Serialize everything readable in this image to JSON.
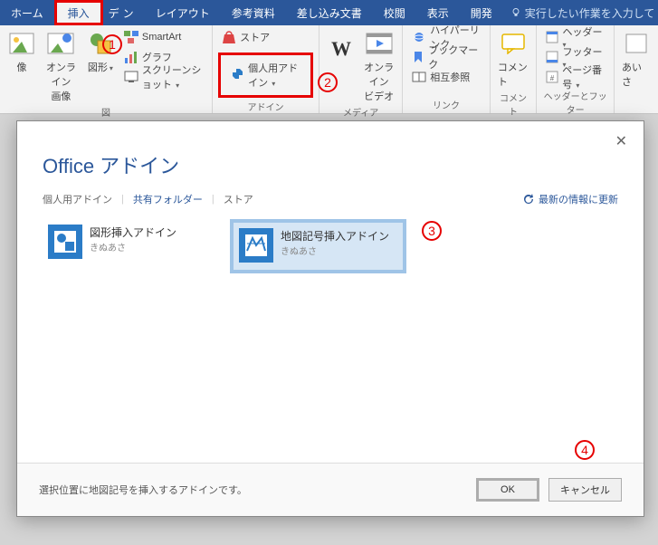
{
  "tabs": {
    "home": "ホーム",
    "insert": "挿入",
    "design_partial": "デ",
    "design_partial2": "ン",
    "layout": "レイアウト",
    "references": "参考資料",
    "mailings": "差し込み文書",
    "review": "校閲",
    "view": "表示",
    "developer": "開発",
    "tellme": "実行したい作業を入力して"
  },
  "ribbon": {
    "pictures": "像",
    "online_images": "オンライン\n画像",
    "shapes": "図形",
    "smartart": "SmartArt",
    "chart": "グラフ",
    "screenshot": "スクリーンショット",
    "illustrations_group": "図",
    "store": "ストア",
    "my_addins": "個人用アドイン",
    "addins_group": "アドイン",
    "wikipedia": "W",
    "online_video": "オンライン\nビデオ",
    "media_group": "メディア",
    "hyperlink": "ハイパーリンク",
    "bookmark": "ブックマーク",
    "crossref": "相互参照",
    "link_group": "リンク",
    "comment": "コメント",
    "comment_group": "コメント",
    "header": "ヘッダー",
    "footer": "フッター",
    "page_number": "ページ番号",
    "header_footer_group": "ヘッダーとフッター",
    "aisatsu": "あいさ\n"
  },
  "dialog": {
    "title": "Office アドイン",
    "tab_my": "個人用アドイン",
    "tab_shared": "共有フォルダー",
    "tab_store": "ストア",
    "refresh": "最新の情報に更新",
    "addins": [
      {
        "title": "図形挿入アドイン",
        "publisher": "きぬあさ"
      },
      {
        "title": "地図記号挿入アドイン",
        "publisher": "きぬあさ"
      }
    ],
    "footer_desc": "選択位置に地図記号を挿入するアドインです。",
    "ok": "OK",
    "cancel": "キャンセル"
  },
  "annotations": {
    "n1": "1",
    "n2": "2",
    "n3": "3",
    "n4": "4"
  }
}
